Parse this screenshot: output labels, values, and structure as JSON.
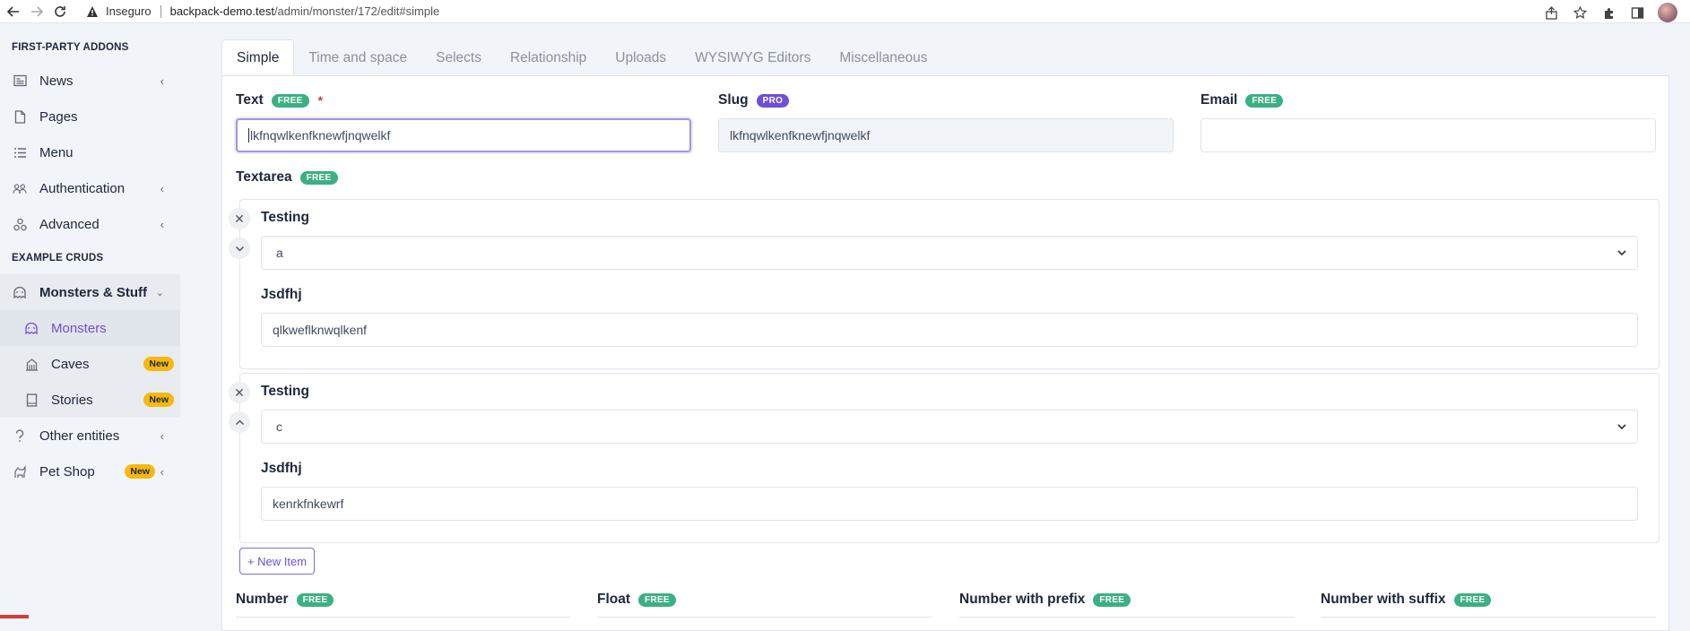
{
  "browser": {
    "security_label": "Inseguro",
    "url_host": "backpack-demo.test",
    "url_path": "/admin/monster/172/edit#simple"
  },
  "sidebar": {
    "sections": [
      {
        "title": "FIRST-PARTY ADDONS"
      },
      {
        "title": "EXAMPLE CRUDS"
      }
    ],
    "items": [
      {
        "label": "News",
        "icon": "newspaper-icon",
        "has_chevron": true
      },
      {
        "label": "Pages",
        "icon": "file-icon",
        "has_chevron": false
      },
      {
        "label": "Menu",
        "icon": "list-icon",
        "has_chevron": false
      },
      {
        "label": "Authentication",
        "icon": "users-icon",
        "has_chevron": true
      },
      {
        "label": "Advanced",
        "icon": "cogs-icon",
        "has_chevron": true
      },
      {
        "label": "Monsters & Stuff",
        "icon": "ghost-icon",
        "has_chevron": true,
        "open": true
      },
      {
        "label": "Monsters",
        "icon": "ghost-icon",
        "active": true
      },
      {
        "label": "Caves",
        "icon": "building-icon",
        "badge": "New"
      },
      {
        "label": "Stories",
        "icon": "book-icon",
        "badge": "New"
      },
      {
        "label": "Other entities",
        "icon": "question-icon",
        "has_chevron": true
      },
      {
        "label": "Pet Shop",
        "icon": "dog-icon",
        "has_chevron": true,
        "badge": "New"
      }
    ]
  },
  "tabs": [
    {
      "label": "Simple",
      "active": true
    },
    {
      "label": "Time and space"
    },
    {
      "label": "Selects"
    },
    {
      "label": "Relationship"
    },
    {
      "label": "Uploads"
    },
    {
      "label": "WYSIWYG Editors"
    },
    {
      "label": "Miscellaneous"
    }
  ],
  "fields": {
    "text": {
      "label": "Text",
      "badge": "FREE",
      "required": "*",
      "value": "lkfnqwlkenfknewfjnqwelkf"
    },
    "slug": {
      "label": "Slug",
      "badge": "PRO",
      "value": "lkfnqwlkenfknewfjnqwelkf"
    },
    "email": {
      "label": "Email",
      "badge": "FREE",
      "value": ""
    },
    "textarea": {
      "label": "Textarea",
      "badge": "FREE"
    }
  },
  "repeatable": [
    {
      "select_label": "Testing",
      "select_value": "a",
      "text_label": "Jsdfhj",
      "text_value": "qlkweflknwqlkenf"
    },
    {
      "select_label": "Testing",
      "select_value": "c",
      "text_label": "Jsdfhj",
      "text_value": "kenrkfnkewrf"
    }
  ],
  "new_item_label": "+ New Item",
  "bottom_fields": [
    {
      "label": "Number",
      "badge": "FREE"
    },
    {
      "label": "Float",
      "badge": "FREE"
    },
    {
      "label": "Number with prefix",
      "badge": "FREE"
    },
    {
      "label": "Number with suffix",
      "badge": "FREE"
    }
  ],
  "colors": {
    "accent": "#6d4fd8",
    "free_badge": "#3bb083",
    "pro_badge": "#6d4fd8",
    "new_badge": "#f6b90e"
  }
}
